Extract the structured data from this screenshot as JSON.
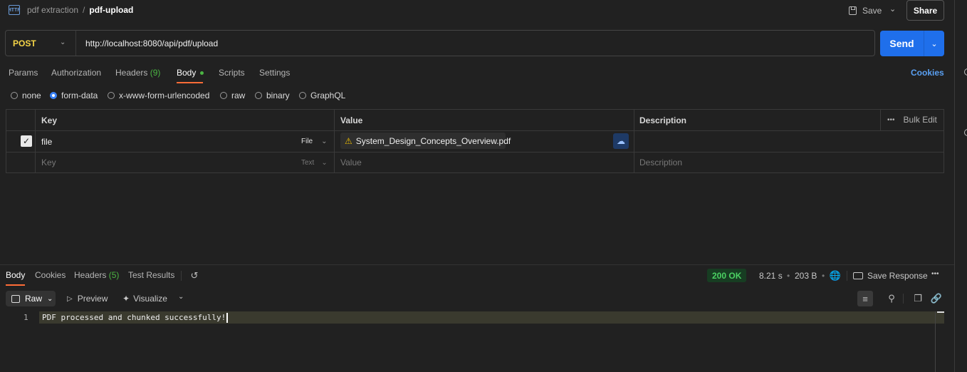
{
  "header": {
    "http_badge": "HTTP",
    "breadcrumb_parent": "pdf extraction",
    "breadcrumb_sep": "/",
    "breadcrumb_current": "pdf-upload",
    "save_label": "Save",
    "share_label": "Share"
  },
  "request": {
    "method": "POST",
    "url": "http://localhost:8080/api/pdf/upload",
    "send_label": "Send"
  },
  "request_tabs": {
    "params": "Params",
    "authorization": "Authorization",
    "headers": "Headers",
    "headers_count": "(9)",
    "body": "Body",
    "scripts": "Scripts",
    "settings": "Settings",
    "cookies": "Cookies"
  },
  "body_types": {
    "none": "none",
    "form_data": "form-data",
    "urlencoded": "x-www-form-urlencoded",
    "raw": "raw",
    "binary": "binary",
    "graphql": "GraphQL",
    "selected": "form-data"
  },
  "form_table": {
    "col_key": "Key",
    "col_value": "Value",
    "col_description": "Description",
    "bulk_edit": "Bulk Edit",
    "rows": [
      {
        "key": "file",
        "type": "File",
        "value": "System_Design_Concepts_Overview.pdf",
        "description": ""
      }
    ],
    "placeholder": {
      "key": "Key",
      "type": "Text",
      "value": "Value",
      "description": "Description"
    }
  },
  "response_tabs": {
    "body": "Body",
    "cookies": "Cookies",
    "headers": "Headers",
    "headers_count": "(5)",
    "test_results": "Test Results"
  },
  "response_meta": {
    "status": "200 OK",
    "time": "8.21 s",
    "size": "203 B",
    "save_response": "Save Response"
  },
  "response_toolbar": {
    "raw": "Raw",
    "preview": "Preview",
    "visualize": "Visualize"
  },
  "response_body": {
    "line_number": "1",
    "text": "PDF processed and chunked successfully!"
  },
  "colors": {
    "accent_blue": "#1f6feb",
    "method_yellow": "#f5d547",
    "tab_orange": "#ff6c37",
    "status_green": "#4bd163"
  }
}
